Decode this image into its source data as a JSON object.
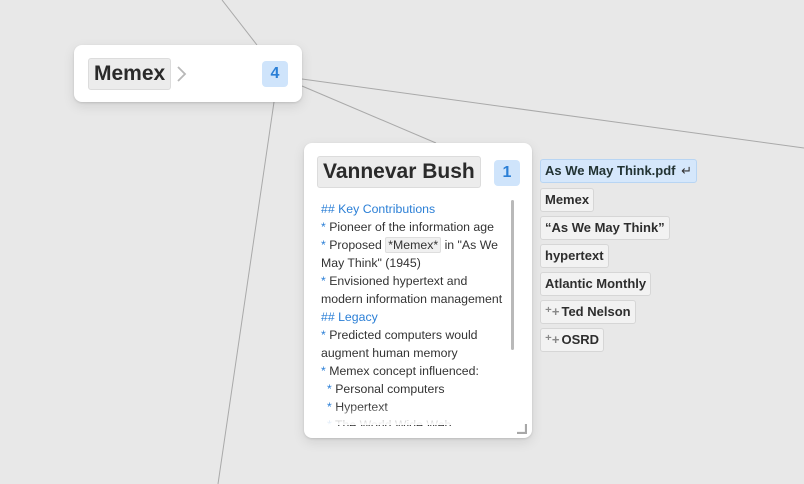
{
  "memex_card": {
    "title": "Memex",
    "count": "4"
  },
  "bush_card": {
    "title": "Vannevar Bush",
    "count": "1",
    "note": [
      {
        "kind": "heading",
        "text": "## Key Contributions"
      },
      {
        "kind": "bullet",
        "text": "Pioneer of the information age"
      },
      {
        "kind": "bullet-chip",
        "pre": "Proposed ",
        "chip": "*Memex*",
        "post": " in \"As We"
      },
      {
        "kind": "cont",
        "text": "May Think\" (1945)"
      },
      {
        "kind": "bullet",
        "text": "Envisioned hypertext and"
      },
      {
        "kind": "cont",
        "text": "modern information management"
      },
      {
        "kind": "heading",
        "text": "## Legacy"
      },
      {
        "kind": "bullet",
        "text": "Predicted computers would"
      },
      {
        "kind": "cont",
        "text": "augment human memory"
      },
      {
        "kind": "bullet",
        "text": "Memex concept influenced:"
      },
      {
        "kind": "sub",
        "text": "Personal computers"
      },
      {
        "kind": "sub",
        "text": "Hypertext"
      },
      {
        "kind": "sub",
        "text": "The World Wide Web"
      }
    ],
    "bullet_mark": "*"
  },
  "tags": [
    {
      "label": "As We May Think.pdf",
      "active": true,
      "suffix": "↵"
    },
    {
      "label": "Memex"
    },
    {
      "label": "“As We May Think”"
    },
    {
      "label": "hypertext"
    },
    {
      "label": "Atlantic Monthly"
    },
    {
      "label": "Ted Nelson",
      "add": true
    },
    {
      "label": "OSRD",
      "add": true
    }
  ],
  "icons": {
    "chevron": "chevron-right-icon",
    "add": "add-link-icon",
    "enter": "enter-key-icon",
    "resize": "resize-handle-icon"
  },
  "colors": {
    "accent": "#2b7fd6",
    "badge_bg": "#cfe4fb",
    "canvas": "#e8e8e8"
  }
}
